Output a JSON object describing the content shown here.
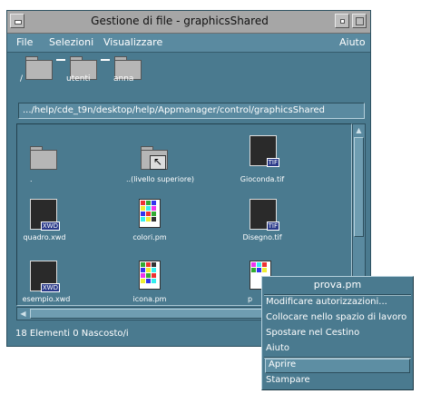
{
  "window": {
    "title": "Gestione di file - graphicsShared"
  },
  "menubar": {
    "file": "File",
    "selezioni": "Selezioni",
    "visualizzare": "Visualizzare",
    "aiuto": "Aiuto"
  },
  "path_icons": [
    {
      "label": "/"
    },
    {
      "label": "utenti"
    },
    {
      "label": "anna"
    }
  ],
  "path_field": {
    "value": ".../help/cde_t9n/desktop/help/Appmanager/control/graphicsShared"
  },
  "files": [
    {
      "label": ".",
      "icon": "folder-icon"
    },
    {
      "label": "..(livello superiore)",
      "icon": "folder-up-icon"
    },
    {
      "label": "Gioconda.tif",
      "icon": "image-tif-icon",
      "tag": "TIF"
    },
    {
      "label": "quadro.xwd",
      "icon": "image-xwd-icon",
      "tag": "XWD"
    },
    {
      "label": "colori.pm",
      "icon": "pixmap-icon"
    },
    {
      "label": "Disegno.tif",
      "icon": "image-tif-icon",
      "tag": "TIF"
    },
    {
      "label": "esempio.xwd",
      "icon": "image-xwd-icon",
      "tag": "XWD"
    },
    {
      "label": "icona.pm",
      "icon": "pixmap-icon"
    },
    {
      "label": "p",
      "icon": "pixmap-icon"
    }
  ],
  "status": {
    "text": "18 Elementi 0 Nascosto/i"
  },
  "popup": {
    "title": "prova.pm",
    "items": [
      "Modificare autorizzazioni...",
      "Collocare nello spazio di lavoro",
      "Spostare nel Cestino",
      "Aiuto",
      "Aprire",
      "Stampare"
    ]
  },
  "colors": {
    "window_bg": "#4a7a8f",
    "titlebar": "#a6a6a6",
    "menubar": "#5a8aa0"
  }
}
